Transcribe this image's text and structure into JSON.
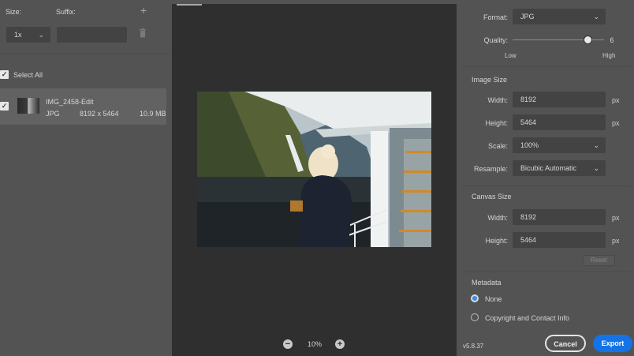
{
  "left_panel": {
    "size_label": "Size:",
    "suffix_label": "Suffix:",
    "add_icon": "plus-icon",
    "scale_value": "1x",
    "suffix_value": "",
    "delete_icon": "trash-icon",
    "select_all_label": "Select All",
    "select_all_checked": true,
    "asset": {
      "name": "IMG_2458-Edit",
      "format": "JPG",
      "dimensions": "8192 x 5464",
      "file_size": "10.9 MB",
      "checked": true
    }
  },
  "preview": {
    "zoom_out_icon": "minus-circle-icon",
    "zoom_in_icon": "plus-circle-icon",
    "zoom_level": "10%"
  },
  "right_panel": {
    "format": {
      "label": "Format:",
      "value": "JPG"
    },
    "quality": {
      "label": "Quality:",
      "value": "6",
      "fraction": 0.83,
      "low_label": "Low",
      "high_label": "High"
    },
    "image_size": {
      "heading": "Image Size",
      "width_label": "Width:",
      "width_value": "8192",
      "height_label": "Height:",
      "height_value": "5464",
      "unit": "px",
      "scale_label": "Scale:",
      "scale_value": "100%",
      "resample_label": "Resample:",
      "resample_value": "Bicubic Automatic"
    },
    "canvas_size": {
      "heading": "Canvas Size",
      "width_label": "Width:",
      "width_value": "8192",
      "height_label": "Height:",
      "height_value": "5464",
      "unit": "px",
      "reset_label": "Reset"
    },
    "metadata": {
      "heading": "Metadata",
      "options": [
        "None",
        "Copyright and Contact Info"
      ],
      "selected": "None"
    }
  },
  "footer": {
    "version": "v5.8.37",
    "cancel_label": "Cancel",
    "export_label": "Export"
  },
  "colors": {
    "panel_bg": "#535353",
    "canvas_bg": "#2f2f2f",
    "input_bg": "#434343",
    "accent": "#1473e6"
  }
}
